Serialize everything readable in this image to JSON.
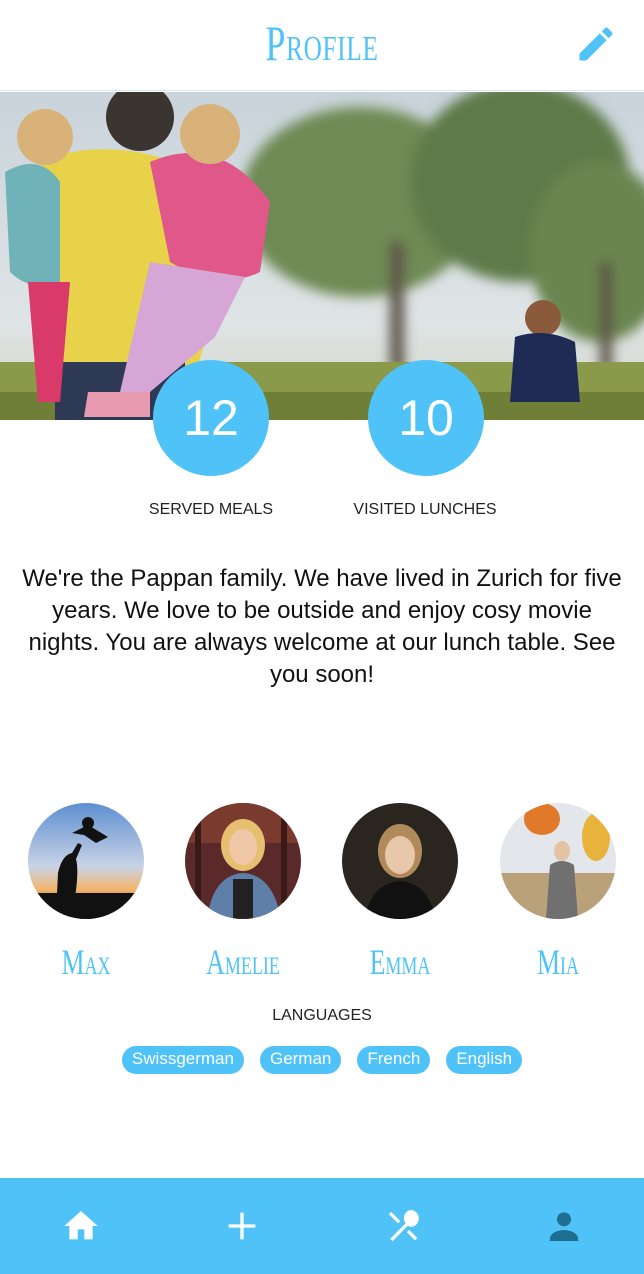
{
  "header": {
    "title": "Profile",
    "edit_icon": "pencil-icon"
  },
  "stats": [
    {
      "value": "12",
      "label": "SERVED MEALS"
    },
    {
      "value": "10",
      "label": "VISITED LUNCHES"
    }
  ],
  "about": "We're the Pappan family. We have lived in Zurich for five years. We love to be outside and enjoy cosy movie nights. You are always welcome at our lunch table. See you soon!",
  "members": [
    {
      "name": "Max"
    },
    {
      "name": "Amelie"
    },
    {
      "name": "Emma"
    },
    {
      "name": "Mia"
    }
  ],
  "languages": {
    "heading": "LANGUAGES",
    "items": [
      "Swissgerman",
      "German",
      "French",
      "English"
    ]
  },
  "nav": {
    "items": [
      {
        "icon": "home-icon"
      },
      {
        "icon": "plus-icon"
      },
      {
        "icon": "cutlery-icon"
      },
      {
        "icon": "person-icon"
      }
    ]
  },
  "colors": {
    "accent": "#4fc3f7",
    "nav_icon_active": "#1f6f93"
  }
}
